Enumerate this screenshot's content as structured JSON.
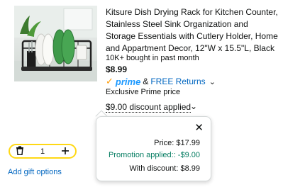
{
  "product": {
    "title": "Kitsure Dish Drying Rack for Kitchen Counter, Stainless Steel Sink Organization and Storage Essentials with Cutlery Holder, Home and Appartment Decor, 12\"W x 15.5\"L, Black",
    "bought": "10K+ bought in past month",
    "price": "$8.99",
    "prime_check": "✓",
    "prime_word": "prime",
    "amp": "&",
    "free_returns": "FREE Returns",
    "exclusive": "Exclusive Prime price",
    "discount": "$9.00 discount applied"
  },
  "popover": {
    "price_line": "Price: $17.99",
    "promo_line": "Promotion applied:: -$9.00",
    "with_discount_line": "With discount: $8.99"
  },
  "quantity": {
    "value": "1"
  },
  "gift": {
    "label": "Add gift options"
  },
  "colors": {
    "prime_blue": "#1a98ff",
    "prime_orange": "#ff9900",
    "link_blue": "#0066c0",
    "promo_green": "#067d62",
    "stepper_border": "#ffd814"
  },
  "icons": {
    "chevron": "chevron-down-icon",
    "close": "close-icon",
    "trash": "trash-icon",
    "plus": "plus-icon"
  }
}
